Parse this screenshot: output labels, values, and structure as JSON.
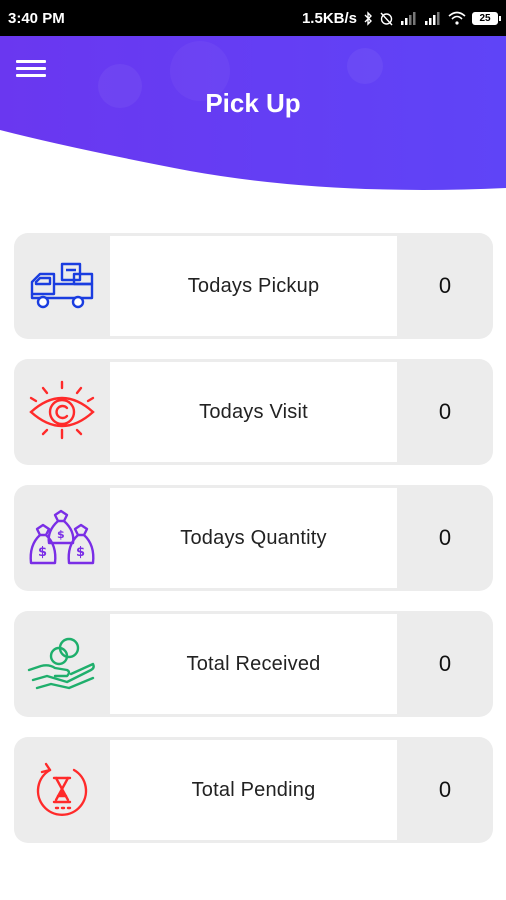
{
  "status": {
    "time": "3:40 PM",
    "speed": "1.5KB/s",
    "battery": "25"
  },
  "header": {
    "title": "Pick Up"
  },
  "colors": {
    "header_purple": "#6a3cf2",
    "blue": "#1a3de0",
    "red": "#ff2a2a",
    "purple": "#7a2ee6",
    "green": "#1faf6c"
  },
  "cards": [
    {
      "label": "Todays Pickup",
      "value": "0",
      "icon": "delivery-truck-icon"
    },
    {
      "label": "Todays Visit",
      "value": "0",
      "icon": "eye-icon"
    },
    {
      "label": "Todays Quantity",
      "value": "0",
      "icon": "money-bags-icon"
    },
    {
      "label": "Total Received",
      "value": "0",
      "icon": "hand-coins-icon"
    },
    {
      "label": "Total Pending",
      "value": "0",
      "icon": "hourglass-icon"
    }
  ]
}
